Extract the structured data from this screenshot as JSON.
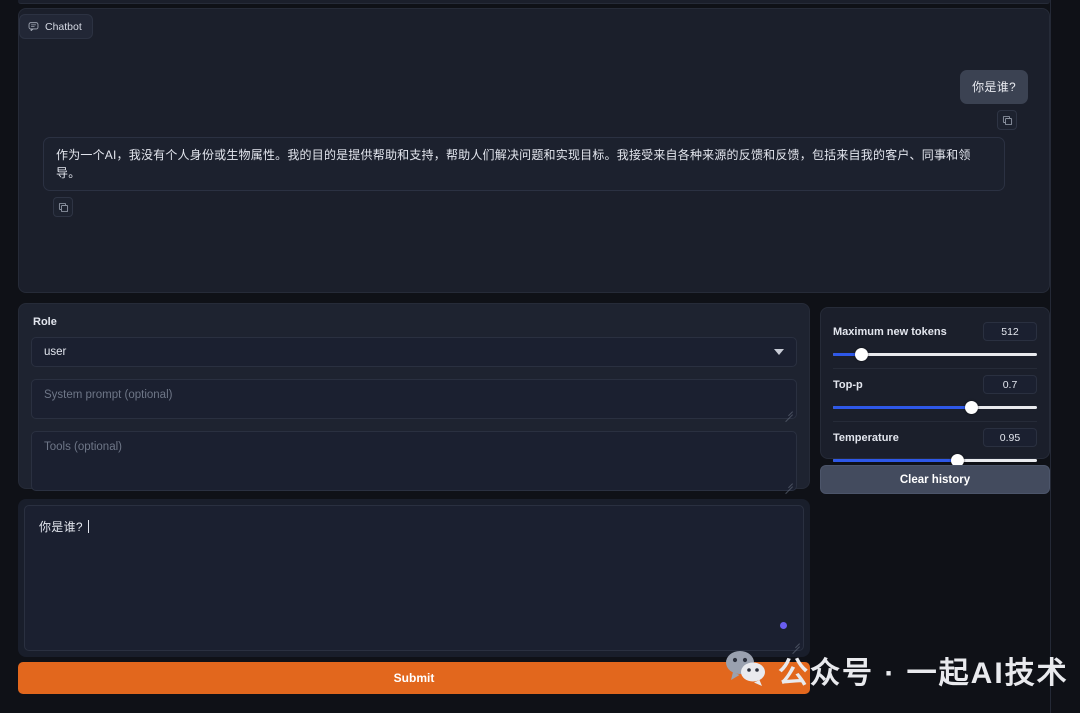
{
  "chatbot": {
    "tab_label": "Chatbot",
    "tab_icon": "chat-bubble-icon",
    "messages": [
      {
        "role": "user",
        "text": "你是谁?",
        "copy_icon": "copy-icon"
      },
      {
        "role": "assistant",
        "text": "作为一个AI，我没有个人身份或生物属性。我的目的是提供帮助和支持，帮助人们解决问题和实现目标。我接受来自各种来源的反馈和反馈，包括来自我的客户、同事和领导。",
        "copy_icon": "copy-icon"
      }
    ]
  },
  "settings": {
    "role": {
      "label": "Role",
      "value": "user",
      "arrow_icon": "chevron-down-icon"
    },
    "system_prompt": {
      "placeholder": "System prompt (optional)",
      "value": ""
    },
    "tools": {
      "placeholder": "Tools (optional)",
      "value": ""
    }
  },
  "parameters": {
    "items": [
      {
        "label": "Maximum new tokens",
        "value": "512",
        "percent": 14
      },
      {
        "label": "Top-p",
        "value": "0.7",
        "percent": 68
      },
      {
        "label": "Temperature",
        "value": "0.95",
        "percent": 61
      }
    ],
    "clear_history_label": "Clear history"
  },
  "input": {
    "value": "你是谁?",
    "placeholder": ""
  },
  "submit": {
    "label": "Submit"
  },
  "watermark": {
    "text": "公众号 · 一起AI技术",
    "icon": "wechat-icon"
  },
  "colors": {
    "page_bg": "#0f1117",
    "panel_bg": "#1b1f2b",
    "settings_bg": "#1e2330",
    "field_bg": "#1b2030",
    "border": "#262b38",
    "accent_submit": "#e2671d",
    "accent_slider": "#2e58e8",
    "user_bubble": "#3b4252",
    "clear_btn": "#434b5e",
    "input_dot": "#6a5df0"
  }
}
